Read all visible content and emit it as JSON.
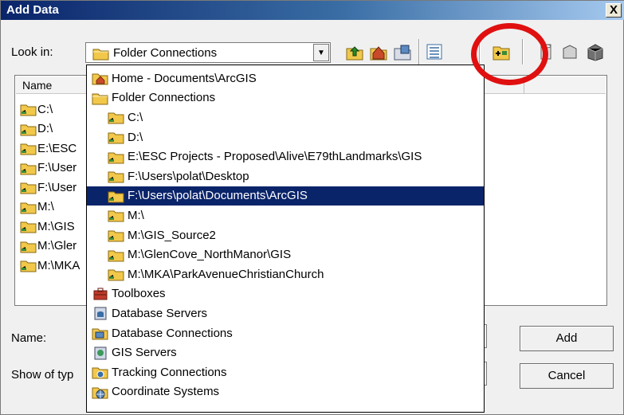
{
  "window": {
    "title": "Add Data",
    "close_label": "X"
  },
  "toolbar": {
    "look_in_label": "Look in:",
    "look_in_value": "Folder Connections",
    "icons": [
      "up-one-level-icon",
      "home-icon",
      "catalog-icon",
      "view-options-icon",
      "connect-folder-icon",
      "new-geodatabase-icon",
      "new-toolbox-icon",
      "new-table-icon"
    ]
  },
  "list": {
    "columns": [
      "Name"
    ],
    "items": [
      "C:\\",
      "D:\\",
      "E:\\ESC",
      "F:\\User",
      "F:\\User",
      "M:\\",
      "M:\\GIS",
      "M:\\Gler",
      "M:\\MKA"
    ]
  },
  "bottom": {
    "name_label": "Name:",
    "show_type_label": "Show of typ",
    "add_button": "Add",
    "cancel_button": "Cancel"
  },
  "dropdown": {
    "items": [
      {
        "label": "Home - Documents\\ArcGIS",
        "indent": 0,
        "icon": "home-folder-icon"
      },
      {
        "label": "Folder Connections",
        "indent": 0,
        "icon": "folder-icon"
      },
      {
        "label": "C:\\",
        "indent": 1,
        "icon": "folder-connection-icon"
      },
      {
        "label": "D:\\",
        "indent": 1,
        "icon": "folder-connection-icon"
      },
      {
        "label": "E:\\ESC Projects - Proposed\\Alive\\E79thLandmarks\\GIS",
        "indent": 1,
        "icon": "folder-connection-icon"
      },
      {
        "label": "F:\\Users\\polat\\Desktop",
        "indent": 1,
        "icon": "folder-connection-icon"
      },
      {
        "label": "F:\\Users\\polat\\Documents\\ArcGIS",
        "indent": 1,
        "icon": "folder-connection-icon",
        "selected": true
      },
      {
        "label": "M:\\",
        "indent": 1,
        "icon": "folder-connection-icon"
      },
      {
        "label": "M:\\GIS_Source2",
        "indent": 1,
        "icon": "folder-connection-icon"
      },
      {
        "label": "M:\\GlenCove_NorthManor\\GIS",
        "indent": 1,
        "icon": "folder-connection-icon"
      },
      {
        "label": "M:\\MKA\\ParkAvenueChristianChurch",
        "indent": 1,
        "icon": "folder-connection-icon"
      },
      {
        "label": "Toolboxes",
        "indent": 0,
        "icon": "toolbox-icon"
      },
      {
        "label": "Database Servers",
        "indent": 0,
        "icon": "database-server-icon"
      },
      {
        "label": "Database Connections",
        "indent": 0,
        "icon": "database-connection-icon"
      },
      {
        "label": "GIS Servers",
        "indent": 0,
        "icon": "gis-server-icon"
      },
      {
        "label": "Tracking Connections",
        "indent": 0,
        "icon": "tracking-connection-icon"
      },
      {
        "label": "Coordinate Systems",
        "indent": 0,
        "icon": "coordinate-system-icon"
      }
    ]
  },
  "colors": {
    "selection": "#0a246a",
    "annotation": "#e01010",
    "folder": "#f2c84b"
  }
}
